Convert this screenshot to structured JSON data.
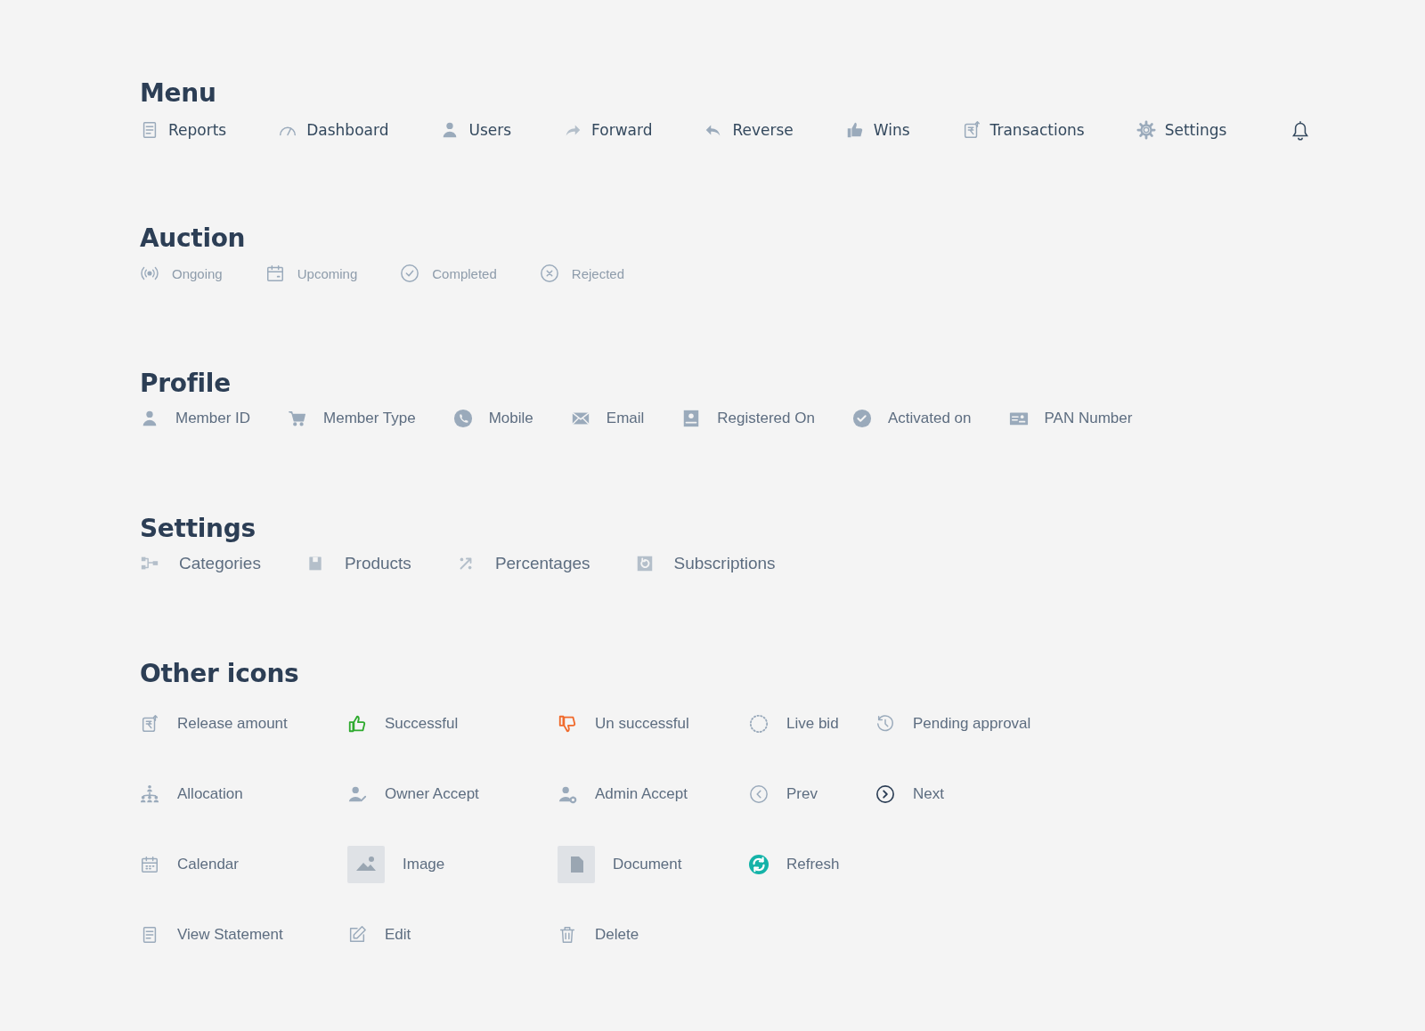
{
  "sections": [
    {
      "title": "Menu",
      "rows": [
        [
          {
            "label": "Reports"
          },
          {
            "label": "Dashboard"
          },
          {
            "label": "Users"
          },
          {
            "label": "Forward"
          },
          {
            "label": "Reverse"
          },
          {
            "label": "Wins"
          },
          {
            "label": "Transactions"
          },
          {
            "label": "Settings"
          }
        ]
      ]
    },
    {
      "title": "Auction",
      "rows": [
        [
          {
            "label": "Ongoing"
          },
          {
            "label": "Upcoming"
          },
          {
            "label": "Completed"
          },
          {
            "label": "Rejected"
          }
        ]
      ]
    },
    {
      "title": "Profile",
      "rows": [
        [
          {
            "label": "Member ID"
          },
          {
            "label": "Member Type"
          },
          {
            "label": "Mobile"
          },
          {
            "label": "Email"
          },
          {
            "label": "Registered On"
          },
          {
            "label": "Activated on"
          },
          {
            "label": "PAN Number"
          }
        ]
      ]
    },
    {
      "title": "Settings",
      "rows": [
        [
          {
            "label": "Categories"
          },
          {
            "label": "Products"
          },
          {
            "label": "Percentages"
          },
          {
            "label": "Subscriptions"
          }
        ]
      ]
    },
    {
      "title": "Other icons",
      "rows": [
        [
          {
            "label": "Release amount"
          },
          {
            "label": "Successful"
          },
          {
            "label": "Un successful"
          },
          {
            "label": "Live bid"
          },
          {
            "label": "Pending approval"
          }
        ],
        [
          {
            "label": "Allocation"
          },
          {
            "label": "Owner Accept"
          },
          {
            "label": "Admin Accept"
          },
          {
            "label": "Prev"
          },
          {
            "label": "Next"
          }
        ],
        [
          {
            "label": "Calendar"
          },
          {
            "label": "Image"
          },
          {
            "label": "Document"
          },
          {
            "label": "Refresh"
          }
        ],
        [
          {
            "label": "View Statement"
          },
          {
            "label": "Edit"
          },
          {
            "label": "Delete"
          }
        ]
      ]
    }
  ]
}
